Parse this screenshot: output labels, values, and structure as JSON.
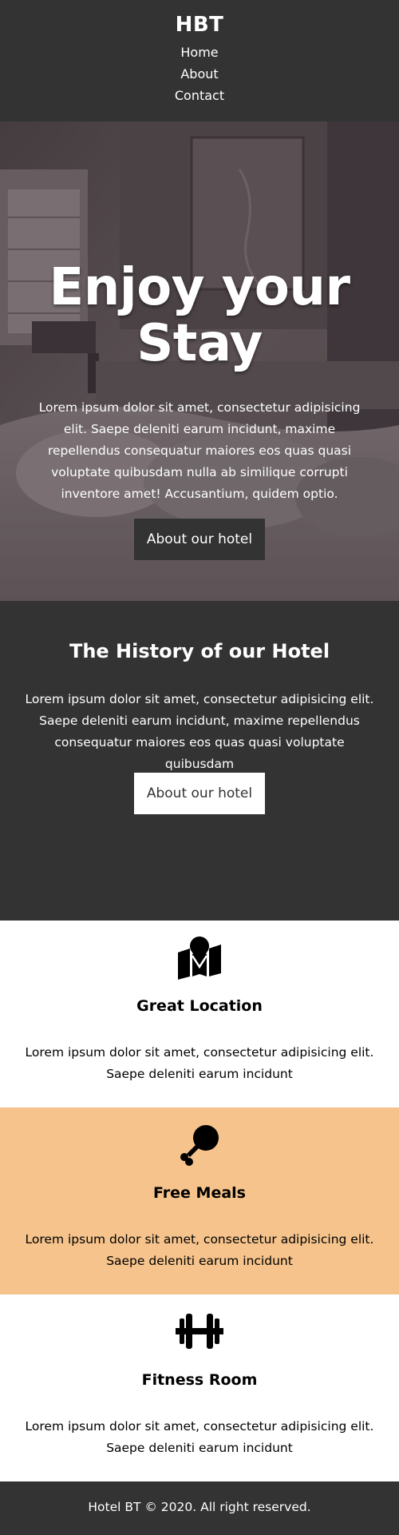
{
  "header": {
    "logo": "HBT",
    "nav": [
      "Home",
      "About",
      "Contact"
    ]
  },
  "hero": {
    "title_line1": "Enjoy your",
    "title_line2": "Stay",
    "text": "Lorem ipsum dolor sit amet, consectetur adipisicing elit. Saepe deleniti earum incidunt, maxime repellendus consequatur maiores eos quas quasi voluptate quibusdam nulla ab similique corrupti inventore amet! Accusantium, quidem optio.",
    "button": "About our hotel"
  },
  "history": {
    "title": "The History of our Hotel",
    "text": "Lorem ipsum dolor sit amet, consectetur adipisicing elit. Saepe deleniti earum incidunt, maxime repellendus consequatur maiores eos quas quasi voluptate quibusdam",
    "button": "About our hotel"
  },
  "features": [
    {
      "icon": "map-marker-icon",
      "title": "Great Location",
      "text": "Lorem ipsum dolor sit amet, consectetur adipisicing elit. Saepe deleniti earum incidunt",
      "bg": "#ffffff"
    },
    {
      "icon": "drumstick-icon",
      "title": "Free Meals",
      "text": "Lorem ipsum dolor sit amet, consectetur adipisicing elit. Saepe deleniti earum incidunt",
      "bg": "#f5c38b"
    },
    {
      "icon": "dumbbell-icon",
      "title": "Fitness Room",
      "text": "Lorem ipsum dolor sit amet, consectetur adipisicing elit. Saepe deleniti earum incidunt",
      "bg": "#ffffff"
    }
  ],
  "footer": {
    "text": "Hotel BT © 2020. All right reserved."
  },
  "colors": {
    "dark": "#333333",
    "accent": "#f5c38b",
    "light": "#ffffff"
  }
}
